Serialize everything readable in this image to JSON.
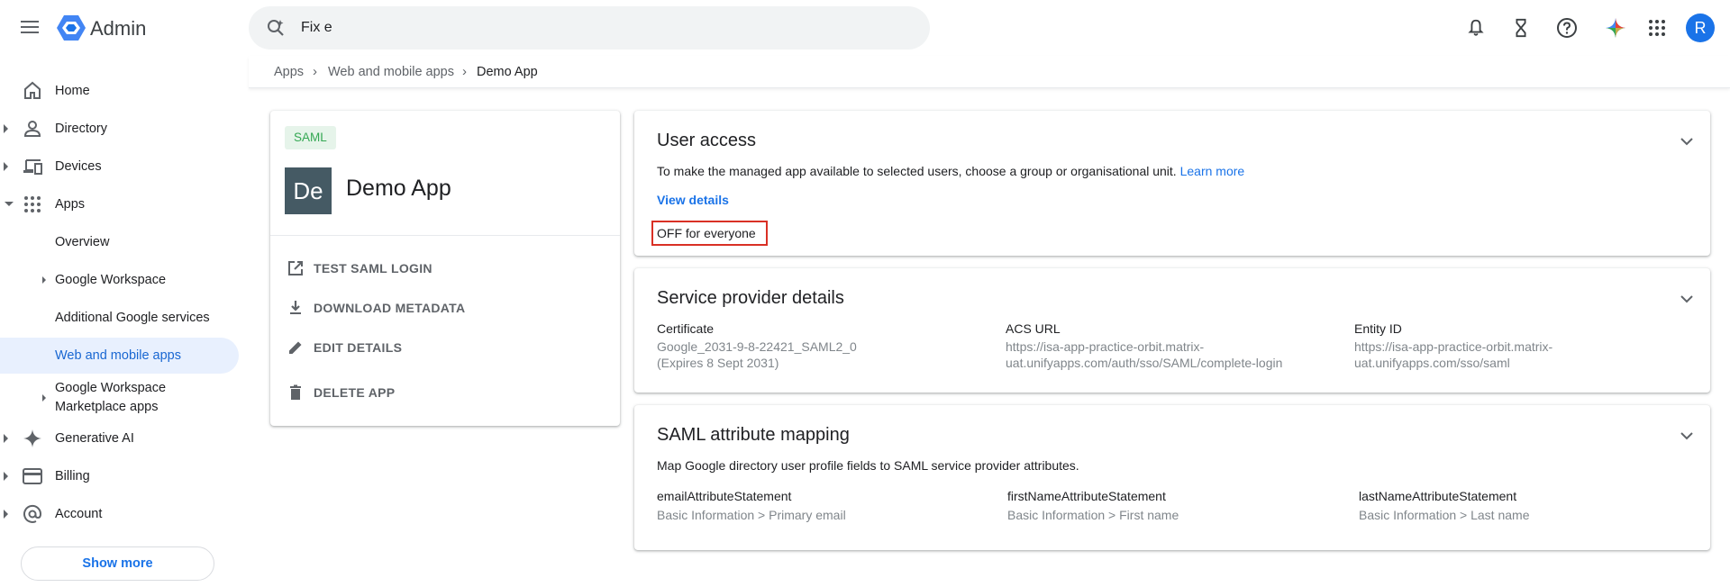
{
  "header": {
    "app_name": "Admin",
    "search_value": "Fix e",
    "avatar_letter": "R",
    "icons": [
      "menu-icon",
      "admin-logo-icon",
      "search-icon",
      "bell-icon",
      "hourglass-icon",
      "help-icon",
      "gemini-icon",
      "apps-grid-icon"
    ]
  },
  "sidebar": {
    "items": [
      {
        "label": "Home"
      },
      {
        "label": "Directory"
      },
      {
        "label": "Devices"
      },
      {
        "label": "Apps"
      },
      {
        "label": "Overview"
      },
      {
        "label": "Google Workspace"
      },
      {
        "label": "Additional Google services"
      },
      {
        "label": "Web and mobile apps"
      },
      {
        "label": "Google Workspace Marketplace apps"
      },
      {
        "label": "Generative AI"
      },
      {
        "label": "Billing"
      },
      {
        "label": "Account"
      }
    ],
    "show_more": "Show more"
  },
  "breadcrumb": {
    "items": [
      "Apps",
      "Web and mobile apps",
      "Demo App"
    ],
    "separator": "›"
  },
  "app_card": {
    "badge": "SAML",
    "tile_initials": "De",
    "title": "Demo App",
    "actions": [
      {
        "label": "TEST SAML LOGIN"
      },
      {
        "label": "DOWNLOAD METADATA"
      },
      {
        "label": "EDIT DETAILS"
      },
      {
        "label": "DELETE APP"
      }
    ]
  },
  "user_access": {
    "title": "User access",
    "description": "To make the managed app available to selected users, choose a group or organisational unit.",
    "learn_more": "Learn more",
    "view_details": "View details",
    "status": "OFF for everyone"
  },
  "service_provider": {
    "title": "Service provider details",
    "fields": [
      {
        "label": "Certificate",
        "line1": "Google_2031-9-8-22421_SAML2_0",
        "line2": "(Expires 8 Sept 2031)"
      },
      {
        "label": "ACS URL",
        "line1": "https://isa-app-practice-orbit.matrix-",
        "line2": "uat.unifyapps.com/auth/sso/SAML/complete-login"
      },
      {
        "label": "Entity ID",
        "line1": "https://isa-app-practice-orbit.matrix-",
        "line2": "uat.unifyapps.com/sso/saml"
      }
    ]
  },
  "saml_mapping": {
    "title": "SAML attribute mapping",
    "description": "Map Google directory user profile fields to SAML service provider attributes.",
    "fields": [
      {
        "label": "emailAttributeStatement",
        "value": "Basic Information > Primary email"
      },
      {
        "label": "firstNameAttributeStatement",
        "value": "Basic Information > First name"
      },
      {
        "label": "lastNameAttributeStatement",
        "value": "Basic Information > Last name"
      }
    ]
  },
  "colors": {
    "accent": "#1a73e8",
    "active_bg": "#e8f0fe",
    "highlight_border": "#d93025",
    "saml_badge_bg": "#e6f4ea",
    "saml_badge_text": "#34a853",
    "tile_bg": "#455a64"
  }
}
